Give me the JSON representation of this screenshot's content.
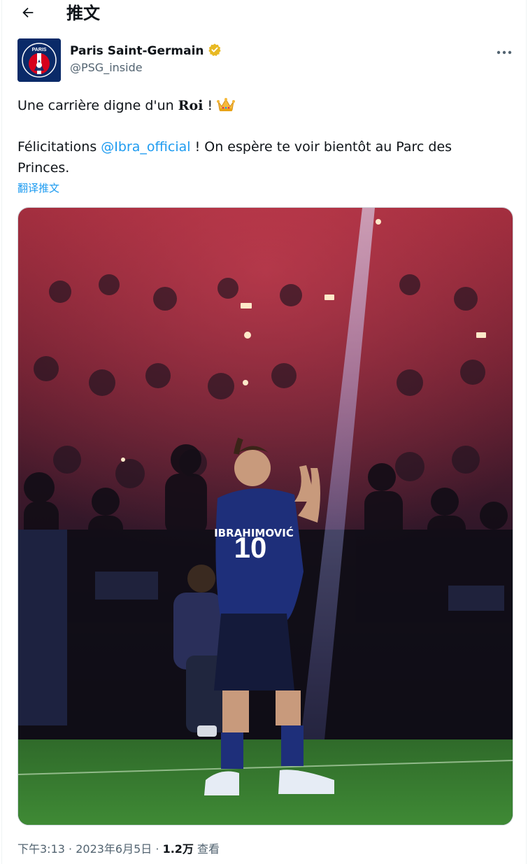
{
  "header": {
    "title": "推文",
    "back_icon": "arrow-left-icon"
  },
  "author": {
    "name": "Paris Saint-Germain",
    "handle": "@PSG_inside",
    "verified_icon": "verified-gold-badge-icon",
    "avatar_text": "PARIS",
    "more_icon": "more-horizontal-icon"
  },
  "tweet": {
    "line1_prefix": "Une carrière digne d'un ",
    "line1_bold": "Roi",
    "line1_suffix": " ! ",
    "crown_icon": "crown-emoji-icon",
    "line2_prefix": "Félicitations ",
    "mention": "@Ibra_official",
    "line2_suffix": " ! On espère te voir bientôt au Parc des Princes.",
    "translate_label": "翻译推文"
  },
  "photo": {
    "jersey_name": "IBRAHIMOVIĆ",
    "jersey_number": "10"
  },
  "meta": {
    "time": "下午3:13",
    "sep1": " · ",
    "date": "2023年6月5日",
    "sep2": " · ",
    "views_count": "1.2万",
    "views_label": " 查看"
  },
  "colors": {
    "link": "#1d9bf0",
    "muted": "#536471",
    "psg_blue": "#0a2a68",
    "psg_red": "#d6001c",
    "badge_gold": "#e8b923"
  }
}
